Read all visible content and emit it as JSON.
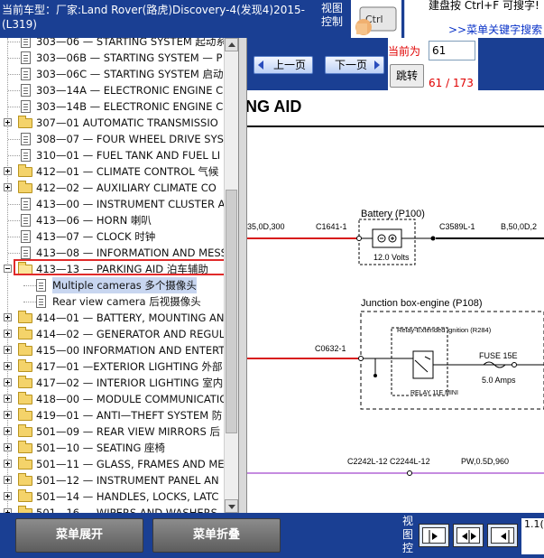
{
  "header": {
    "car_info": "当前车型：厂家:Land Rover(路虎)Discovery-4(发现4)2015-(L319)",
    "view_control_label": "视图控制",
    "search_hint": "建盘按 Ctrl+F 可搜字!",
    "search_link": ">>菜单关键字搜索"
  },
  "tree": {
    "items": [
      {
        "label": "303—06 — STARTING SYSTEM 起动系",
        "kind": "doc"
      },
      {
        "label": "303—06B — STARTING SYSTEM — P",
        "kind": "doc"
      },
      {
        "label": "303—06C — STARTING SYSTEM 启动",
        "kind": "doc"
      },
      {
        "label": "303—14A — ELECTRONIC ENGINE C",
        "kind": "doc"
      },
      {
        "label": "303—14B — ELECTRONIC ENGINE C",
        "kind": "doc"
      },
      {
        "label": "307—01 AUTOMATIC TRANSMISSIO",
        "kind": "folder"
      },
      {
        "label": "308—07 — FOUR WHEEL DRIVE SYS",
        "kind": "doc"
      },
      {
        "label": "310—01 — FUEL TANK AND FUEL LI",
        "kind": "doc"
      },
      {
        "label": "412—01 — CLIMATE CONTROL 气候",
        "kind": "folder"
      },
      {
        "label": "412—02 — AUXILIARY CLIMATE CO",
        "kind": "folder"
      },
      {
        "label": "413—00 — INSTRUMENT CLUSTER A",
        "kind": "doc"
      },
      {
        "label": "413—06 — HORN 喇叭",
        "kind": "doc"
      },
      {
        "label": "413—07 — CLOCK 时钟",
        "kind": "doc"
      },
      {
        "label": "413—08 — INFORMATION AND MESS",
        "kind": "doc"
      },
      {
        "label": "413—13 — PARKING AID 泊车辅助",
        "kind": "folder-open"
      },
      {
        "label": "Multiple cameras 多个摄像头",
        "kind": "child-selected"
      },
      {
        "label": "Rear view camera 后视摄像头",
        "kind": "child"
      },
      {
        "label": "414—01 — BATTERY, MOUNTING AN",
        "kind": "folder"
      },
      {
        "label": "414—02 — GENERATOR AND REGUL",
        "kind": "folder"
      },
      {
        "label": "415—00 INFORMATION AND ENTERT",
        "kind": "folder"
      },
      {
        "label": "417—01 —EXTERIOR LIGHTING 外部",
        "kind": "folder"
      },
      {
        "label": "417—02 — INTERIOR LIGHTING 室内",
        "kind": "folder"
      },
      {
        "label": "418—00 — MODULE COMMUNICATIO",
        "kind": "folder"
      },
      {
        "label": "419—01 — ANTI—THEFT SYSTEM 防",
        "kind": "folder"
      },
      {
        "label": "501—09 — REAR VIEW MIRRORS 后",
        "kind": "folder"
      },
      {
        "label": "501—10 — SEATING 座椅",
        "kind": "folder"
      },
      {
        "label": "501—11 — GLASS, FRAMES AND ME",
        "kind": "folder"
      },
      {
        "label": "501—12 — INSTRUMENT PANEL AN",
        "kind": "folder"
      },
      {
        "label": "501—14 — HANDLES, LOCKS, LATC",
        "kind": "folder"
      },
      {
        "label": "501—16 — WIPERS AND WASHERS—",
        "kind": "folder"
      }
    ]
  },
  "toolbar": {
    "prev_label": "上一页",
    "next_label": "下一页",
    "current_label": "当前为",
    "page_value": "61",
    "goto_label": "跳转",
    "page_count": "61 / 173"
  },
  "document": {
    "title": "NG AID",
    "diagram": {
      "battery_title": "Battery (P100)",
      "battery_volts": "12.0 Volts",
      "wire_left_1": "35,0D,300",
      "conn_c1641": "C1641-1",
      "conn_c3589": "C3589L-1",
      "wire_right_1": "B,50,0D,2",
      "junction_title": "Junction box-engine (P108)",
      "relay_title": "Relay-Extended ignition (R284)",
      "relay_label": "RELAY 11E MINI",
      "conn_c0632": "C0632-1",
      "fuse_label": "FUSE 15E",
      "fuse_amps": "5.0 Amps",
      "conn_c2242": "C2242L-12 C2244L-12",
      "wire_pw": "PW,0.5D,960"
    }
  },
  "bottom": {
    "expand_label": "菜单展开",
    "collapse_label": "菜单折叠",
    "view_control_label": "视图控",
    "corner_text": "1.1("
  }
}
